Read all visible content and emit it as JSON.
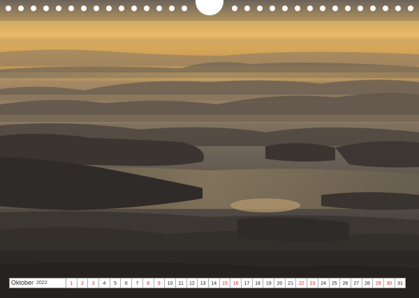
{
  "calendar": {
    "month": "Oktober",
    "year": "2022",
    "days": [
      {
        "n": "1",
        "red": true
      },
      {
        "n": "2",
        "red": true
      },
      {
        "n": "3",
        "red": true
      },
      {
        "n": "4",
        "red": false
      },
      {
        "n": "5",
        "red": false
      },
      {
        "n": "6",
        "red": false
      },
      {
        "n": "7",
        "red": false
      },
      {
        "n": "8",
        "red": true
      },
      {
        "n": "9",
        "red": true
      },
      {
        "n": "10",
        "red": false
      },
      {
        "n": "11",
        "red": false
      },
      {
        "n": "12",
        "red": false
      },
      {
        "n": "13",
        "red": false
      },
      {
        "n": "14",
        "red": false
      },
      {
        "n": "15",
        "red": true
      },
      {
        "n": "16",
        "red": true
      },
      {
        "n": "17",
        "red": false
      },
      {
        "n": "18",
        "red": false
      },
      {
        "n": "19",
        "red": false
      },
      {
        "n": "20",
        "red": false
      },
      {
        "n": "21",
        "red": false
      },
      {
        "n": "22",
        "red": true
      },
      {
        "n": "23",
        "red": true
      },
      {
        "n": "24",
        "red": false
      },
      {
        "n": "25",
        "red": false
      },
      {
        "n": "26",
        "red": false
      },
      {
        "n": "27",
        "red": false
      },
      {
        "n": "28",
        "red": false
      },
      {
        "n": "29",
        "red": true
      },
      {
        "n": "30",
        "red": true
      },
      {
        "n": "31",
        "red": false
      }
    ]
  },
  "colors": {
    "sky_gold": "#e8b65a",
    "mist": "#b59a72",
    "hills_dark": "#3a3632",
    "weekend_red": "#d22222"
  }
}
